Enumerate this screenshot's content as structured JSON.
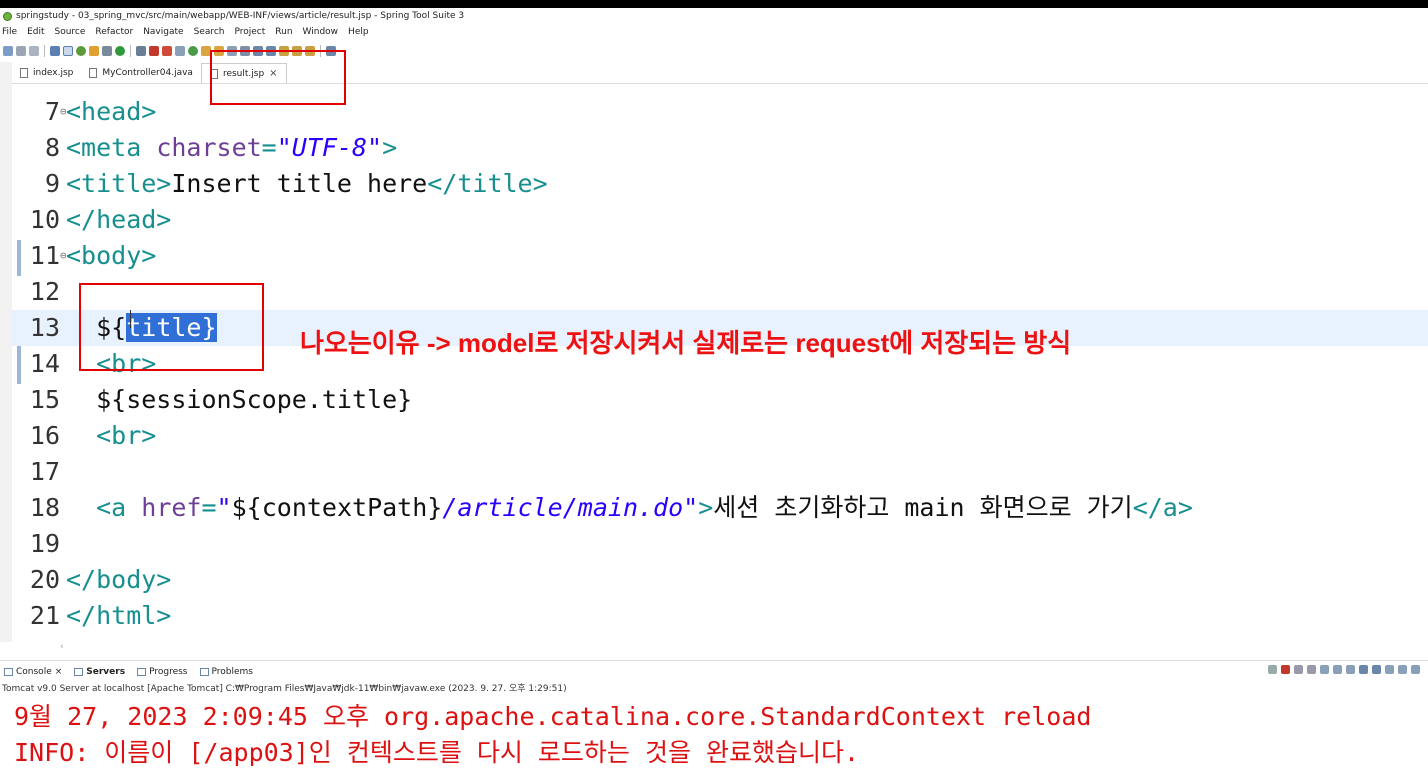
{
  "window": {
    "title": "springstudy - 03_spring_mvc/src/main/webapp/WEB-INF/views/article/result.jsp - Spring Tool Suite 3"
  },
  "menu": [
    "File",
    "Edit",
    "Source",
    "Refactor",
    "Navigate",
    "Search",
    "Project",
    "Run",
    "Window",
    "Help"
  ],
  "tabs": [
    {
      "label": "index.jsp"
    },
    {
      "label": "MyController04.java"
    },
    {
      "label": "result.jsp",
      "close": "×"
    }
  ],
  "editor": {
    "lines": [
      {
        "n": "7",
        "fold": "⊖",
        "segs": [
          {
            "t": "<head>",
            "c": "tag"
          }
        ]
      },
      {
        "n": "8",
        "segs": [
          {
            "t": "<meta ",
            "c": "tag"
          },
          {
            "t": "charset",
            "c": "attr"
          },
          {
            "t": "=",
            "c": "tag"
          },
          {
            "t": "\"UTF-8\"",
            "c": "str"
          },
          {
            "t": ">",
            "c": "tag"
          }
        ]
      },
      {
        "n": "9",
        "segs": [
          {
            "t": "<title>",
            "c": "tag"
          },
          {
            "t": "Insert title here",
            "c": "plain"
          },
          {
            "t": "</title>",
            "c": "tag"
          }
        ]
      },
      {
        "n": "10",
        "segs": [
          {
            "t": "</head>",
            "c": "tag"
          }
        ]
      },
      {
        "n": "11",
        "fold": "⊖",
        "segs": [
          {
            "t": "<body>",
            "c": "tag"
          }
        ]
      },
      {
        "n": "12",
        "segs": []
      },
      {
        "n": "13",
        "hl": true,
        "segs": [
          {
            "t": "  ${",
            "c": "plain"
          },
          {
            "t": "title}",
            "c": "sel"
          }
        ]
      },
      {
        "n": "14",
        "segs": [
          {
            "t": "  ",
            "c": "plain"
          },
          {
            "t": "<br>",
            "c": "tag"
          }
        ]
      },
      {
        "n": "15",
        "segs": [
          {
            "t": "  ${sessionScope.title}",
            "c": "plain"
          }
        ]
      },
      {
        "n": "16",
        "segs": [
          {
            "t": "  ",
            "c": "plain"
          },
          {
            "t": "<br>",
            "c": "tag"
          }
        ]
      },
      {
        "n": "17",
        "segs": []
      },
      {
        "n": "18",
        "segs": [
          {
            "t": "  ",
            "c": "plain"
          },
          {
            "t": "<a ",
            "c": "tag"
          },
          {
            "t": "href",
            "c": "attr"
          },
          {
            "t": "=",
            "c": "tag"
          },
          {
            "t": "\"",
            "c": "str"
          },
          {
            "t": "${contextPath}",
            "c": "plain"
          },
          {
            "t": "/article/main.do\"",
            "c": "str"
          },
          {
            "t": ">",
            "c": "tag"
          },
          {
            "t": "세션 초기화하고 main 화면으로 가기",
            "c": "plain"
          },
          {
            "t": "</a>",
            "c": "tag"
          }
        ]
      },
      {
        "n": "19",
        "segs": []
      },
      {
        "n": "20",
        "segs": [
          {
            "t": "</body>",
            "c": "tag"
          }
        ]
      },
      {
        "n": "21",
        "segs": [
          {
            "t": "</html>",
            "c": "tag"
          }
        ]
      }
    ]
  },
  "annotation": "나오는이유 -> model로 저장시켜서 실제로는 request에 저장되는 방식",
  "bottom": {
    "tabs": [
      {
        "label": "Console",
        "close": "×"
      },
      {
        "label": "Servers"
      },
      {
        "label": "Progress"
      },
      {
        "label": "Problems"
      }
    ],
    "server_line": "Tomcat v9.0 Server at localhost [Apache Tomcat] C:₩Program Files₩Java₩jdk-11₩bin₩javaw.exe  (2023. 9. 27. 오후 1:29:51)",
    "console": [
      "9월 27, 2023 2:09:45 오후 org.apache.catalina.core.StandardContext reload",
      "INFO: 이름이 [/app03]인 컨텍스트를 다시 로드하는 것을 완료했습니다."
    ]
  },
  "colors": {
    "tag": "#178f8f",
    "attr": "#6d3f96",
    "string": "#2a00ff",
    "annotation": "#ee1111",
    "console": "#dd1111",
    "selection": "#2f6fd6"
  }
}
